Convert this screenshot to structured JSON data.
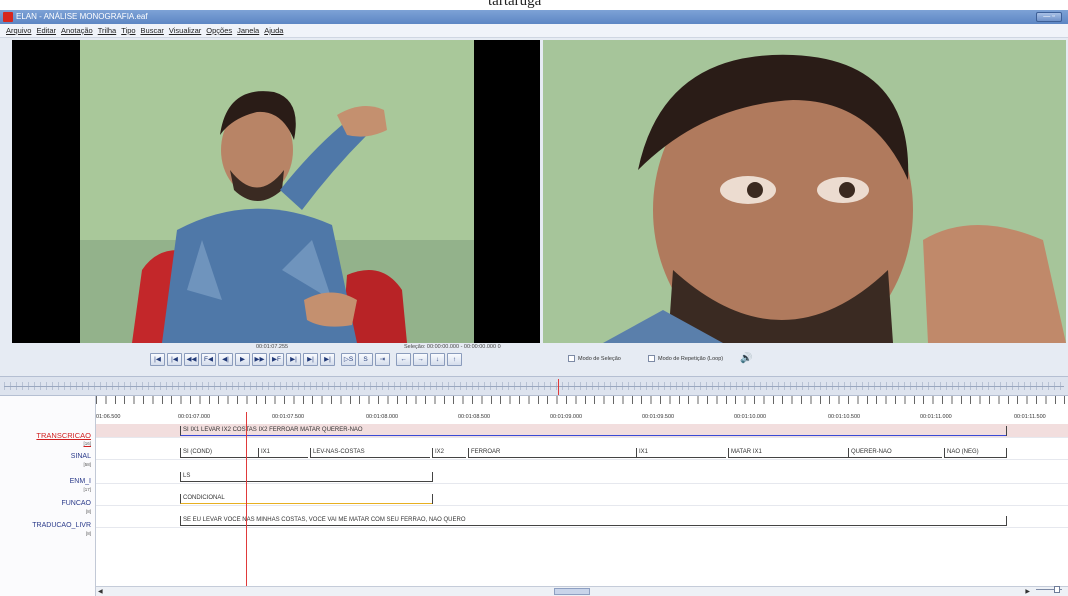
{
  "caption": "tartaruga",
  "window": {
    "title": "ELAN - ANÁLISE MONOGRAFIA.eaf"
  },
  "menu": [
    "Arquivo",
    "Editar",
    "Anotação",
    "Trilha",
    "Tipo",
    "Buscar",
    "Visualizar",
    "Opções",
    "Janela",
    "Ajuda"
  ],
  "player": {
    "current_time": "00:01:07.255",
    "selection": "Seleção: 00:00:00.000 - 00:00:00.000  0",
    "buttons": [
      "|◀",
      "|◀",
      "◀◀",
      "F◀",
      "◀|",
      "▶",
      "▶▶",
      "▶F",
      "▶|",
      "▶|",
      "▶|"
    ],
    "buttons2": [
      "▷S",
      "S",
      "⇥"
    ],
    "nav_buttons": [
      "←",
      "→",
      "↓",
      "↑"
    ],
    "selection_mode": "Modo de Seleção",
    "loop_mode": "Modo de Repetição (Loop)"
  },
  "timeline": {
    "tick_labels": [
      "01:06.500",
      "00:01:07.000",
      "00:01:07.500",
      "00:01:08.000",
      "00:01:08.500",
      "00:01:09.000",
      "00:01:09.500",
      "00:01:10.000",
      "00:01:10.500",
      "00:01:11.000",
      "00:01:11.500"
    ]
  },
  "tiers": [
    {
      "name": "TRANSCRICAO",
      "count": "[16]"
    },
    {
      "name": "SINAL",
      "count": "[58]"
    },
    {
      "name": "ENM_I",
      "count": "[17]"
    },
    {
      "name": "FUNCAO",
      "count": "[8]"
    },
    {
      "name": "TRADUCAO_LIVR",
      "count": "[8]"
    }
  ],
  "annotations": {
    "transcricao": "SI IX1 LEVAR IX2 COSTAS IX2 FERROAR MATAR QUERER-NÃO",
    "sinal": [
      "SI (COND)",
      "IX1",
      "LEV-NAS-COSTAS",
      "IX2",
      "FERROAR",
      "IX1",
      "MATAR IX1",
      "QUERER-NÃO",
      "NÃO (NEG)"
    ],
    "enm": "LS",
    "funcao": "CONDICIONAL",
    "traducao": "SE EU LEVAR VOCÊ NAS MINHAS COSTAS, VOCÊ VAI ME MATAR COM SEU FERRÃO, NÃO QUERO"
  },
  "icons": {
    "app": "elan-icon",
    "speaker": "speaker-icon"
  },
  "colors": {
    "playhead": "#e03a3a",
    "trans_line": "#3a4bd6",
    "func_line": "#e8b020",
    "active_tier": "#d02020"
  }
}
